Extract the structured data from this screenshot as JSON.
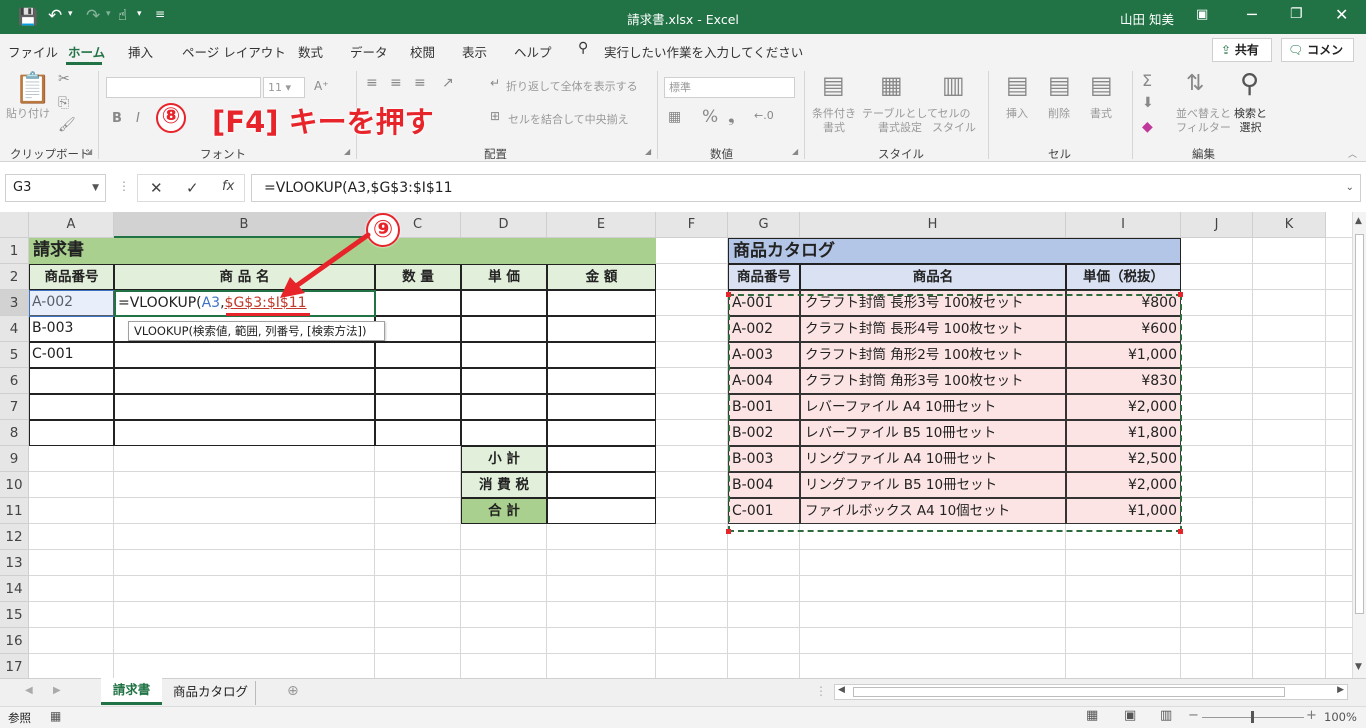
{
  "window": {
    "title": "請求書.xlsx - Excel",
    "user": "山田 知美"
  },
  "menu": {
    "items": [
      "ファイル",
      "ホーム",
      "挿入",
      "ページ レイアウト",
      "数式",
      "データ",
      "校閲",
      "表示",
      "ヘルプ"
    ],
    "tell_me": "実行したい作業を入力してください",
    "share": "共有",
    "comment": "コメント"
  },
  "ribbon": {
    "groups": [
      "クリップボード",
      "フォント",
      "配置",
      "数値",
      "スタイル",
      "セル",
      "編集"
    ],
    "clipboard": {
      "paste": "貼り付け"
    },
    "font": {
      "size": "11"
    },
    "alignment": {
      "wrap": "折り返して全体を表示する",
      "merge": "セルを結合して中央揃え"
    },
    "number": {
      "format": "標準"
    },
    "styles": {
      "conditional": "条件付き\n書式",
      "table": "テーブルとして\n書式設定",
      "cell": "セルの\nスタイル"
    },
    "cells": {
      "insert": "挿入",
      "delete": "削除",
      "format": "書式"
    },
    "editing": {
      "sort": "並べ替えと\nフィルター",
      "find": "検索と\n選択"
    }
  },
  "formula_bar": {
    "name_box": "G3",
    "formula": "=VLOOKUP(A3,$G$3:$I$11"
  },
  "annotations": {
    "step8_num": "⑧",
    "step8_text": "[F4] キーを押す",
    "step9_num": "⑨"
  },
  "columns": [
    "A",
    "B",
    "C",
    "D",
    "E",
    "F",
    "G",
    "H",
    "I",
    "J",
    "K"
  ],
  "rows": [
    "1",
    "2",
    "3",
    "4",
    "5",
    "6",
    "7",
    "8",
    "9",
    "10",
    "11",
    "12",
    "13",
    "14",
    "15",
    "16",
    "17"
  ],
  "invoice": {
    "title": "請求書",
    "headers": [
      "商品番号",
      "商 品 名",
      "数 量",
      "単 価",
      "金 額"
    ],
    "ids": [
      "A-002",
      "B-003",
      "C-001"
    ],
    "edit_prefix": "=VLOOKUP(",
    "edit_ref1": "A3",
    "edit_comma": ",",
    "edit_ref2": "$G$3:$I$11",
    "tooltip": "VLOOKUP(検索値, 範囲, 列番号, [検索方法])",
    "subtotal": "小 計",
    "tax": "消 費 税",
    "total": "合 計"
  },
  "catalog": {
    "title": "商品カタログ",
    "headers": [
      "商品番号",
      "商品名",
      "単価（税抜）"
    ],
    "rows": [
      {
        "id": "A-001",
        "name": "クラフト封筒 長形3号 100枚セット",
        "price": "¥800"
      },
      {
        "id": "A-002",
        "name": "クラフト封筒 長形4号 100枚セット",
        "price": "¥600"
      },
      {
        "id": "A-003",
        "name": "クラフト封筒 角形2号 100枚セット",
        "price": "¥1,000"
      },
      {
        "id": "A-004",
        "name": "クラフト封筒 角形3号 100枚セット",
        "price": "¥830"
      },
      {
        "id": "B-001",
        "name": "レバーファイル A4 10冊セット",
        "price": "¥2,000"
      },
      {
        "id": "B-002",
        "name": "レバーファイル B5 10冊セット",
        "price": "¥1,800"
      },
      {
        "id": "B-003",
        "name": "リングファイル A4 10冊セット",
        "price": "¥2,500"
      },
      {
        "id": "B-004",
        "name": "リングファイル B5 10冊セット",
        "price": "¥2,000"
      },
      {
        "id": "C-001",
        "name": "ファイルボックス A4 10個セット",
        "price": "¥1,000"
      }
    ]
  },
  "sheets": [
    "請求書",
    "商品カタログ"
  ],
  "status": {
    "mode": "参照",
    "zoom": "100%"
  },
  "colors": {
    "excel_green": "#217346",
    "invoice_header": "#a9d08e",
    "invoice_sub": "#e2efda",
    "catalog_title": "#b4c6e7",
    "catalog_header": "#d9e1f2",
    "catalog_row": "#fce4e4",
    "annotation_red": "#e8242b"
  }
}
